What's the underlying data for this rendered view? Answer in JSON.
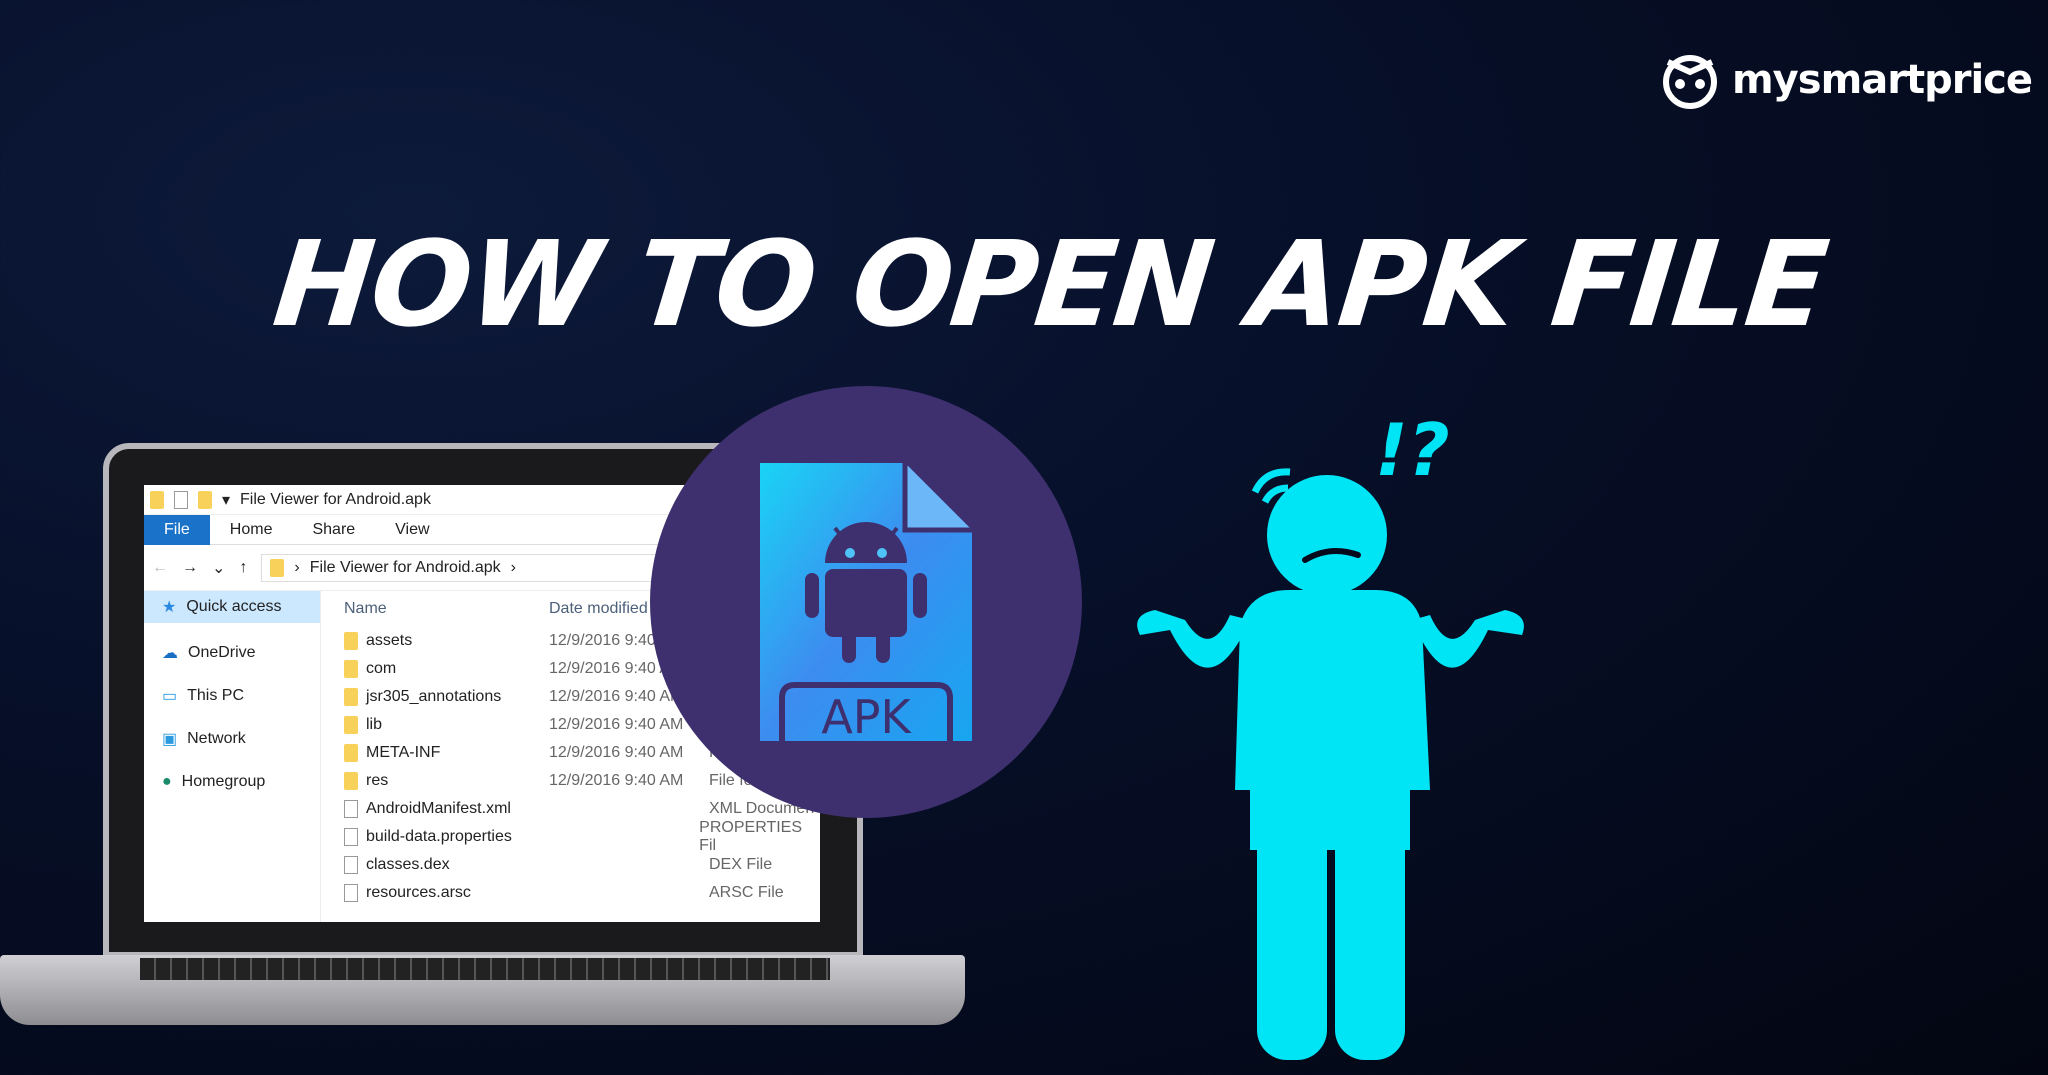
{
  "brand": {
    "name": "mysmartprice",
    "icon": "owl-logo-icon"
  },
  "headline": "HOW TO OPEN APK FILE",
  "explorer": {
    "window_title": "File Viewer for Android.apk",
    "ribbon": [
      "File",
      "Home",
      "Share",
      "View"
    ],
    "address": "File Viewer for Android.apk",
    "nav": [
      {
        "label": "Quick access",
        "icon": "star-icon"
      },
      {
        "label": "OneDrive",
        "icon": "cloud-icon"
      },
      {
        "label": "This PC",
        "icon": "monitor-icon"
      },
      {
        "label": "Network",
        "icon": "network-icon"
      },
      {
        "label": "Homegroup",
        "icon": "homegroup-icon"
      }
    ],
    "columns": [
      "Name",
      "Date modified"
    ],
    "files": [
      {
        "name": "assets",
        "date": "12/9/2016 9:40",
        "type": "",
        "kind": "folder"
      },
      {
        "name": "com",
        "date": "12/9/2016 9:40 A",
        "type": "",
        "kind": "folder"
      },
      {
        "name": "jsr305_annotations",
        "date": "12/9/2016 9:40 AM",
        "type": "",
        "kind": "folder"
      },
      {
        "name": "lib",
        "date": "12/9/2016 9:40 AM",
        "type": "",
        "kind": "folder"
      },
      {
        "name": "META-INF",
        "date": "12/9/2016 9:40 AM",
        "type": "Fi",
        "kind": "folder"
      },
      {
        "name": "res",
        "date": "12/9/2016 9:40 AM",
        "type": "File fold",
        "kind": "folder"
      },
      {
        "name": "AndroidManifest.xml",
        "date": "",
        "type": "XML Documen",
        "kind": "file"
      },
      {
        "name": "build-data.properties",
        "date": "",
        "type": "PROPERTIES Fil",
        "kind": "file"
      },
      {
        "name": "classes.dex",
        "date": "",
        "type": "DEX File",
        "kind": "file"
      },
      {
        "name": "resources.arsc",
        "date": "",
        "type": "ARSC File",
        "kind": "file"
      }
    ]
  },
  "apk_icon": {
    "label": "APK",
    "icon": "android-apk-file-icon"
  },
  "person": {
    "marks": "!?",
    "icon": "confused-person-shrug-icon"
  },
  "colors": {
    "accent": "#00e5f5",
    "circle": "#3e2f6e",
    "background": "#050a1c"
  }
}
